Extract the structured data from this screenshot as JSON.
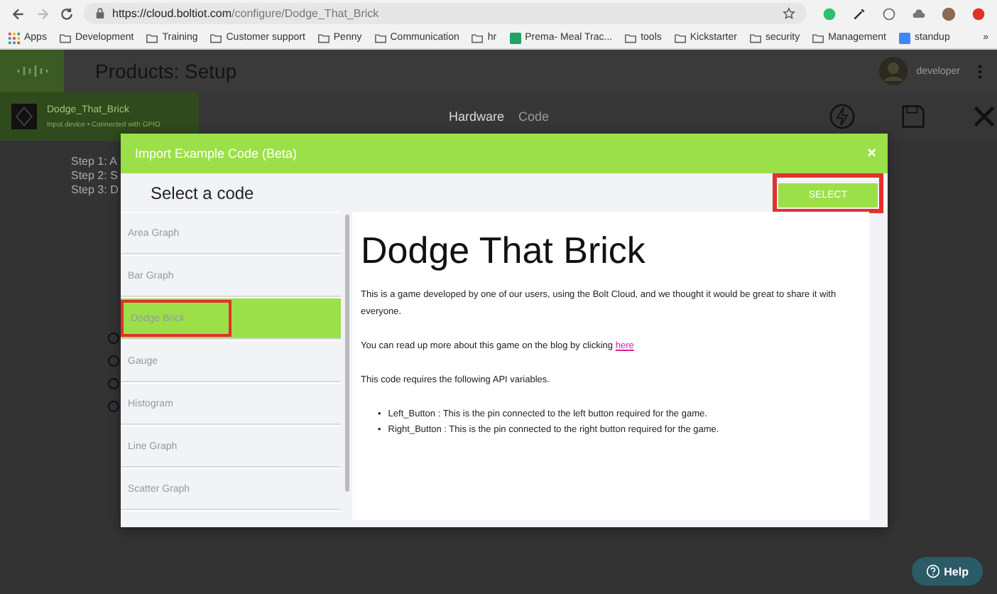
{
  "browser": {
    "url_host": "https://cloud.boltiot.com",
    "url_path": "/configure/Dodge_That_Brick",
    "bookmarks": [
      {
        "label": "Apps",
        "kind": "apps"
      },
      {
        "label": "Development",
        "kind": "folder"
      },
      {
        "label": "Training",
        "kind": "folder"
      },
      {
        "label": "Customer support",
        "kind": "folder"
      },
      {
        "label": "Penny",
        "kind": "folder"
      },
      {
        "label": "Communication",
        "kind": "folder"
      },
      {
        "label": "hr",
        "kind": "folder"
      },
      {
        "label": "Prema- Meal Trac...",
        "kind": "sheet"
      },
      {
        "label": "tools",
        "kind": "folder"
      },
      {
        "label": "Kickstarter",
        "kind": "folder"
      },
      {
        "label": "security",
        "kind": "folder"
      },
      {
        "label": "Management",
        "kind": "folder"
      },
      {
        "label": "standup",
        "kind": "doc"
      }
    ],
    "more": "»"
  },
  "app": {
    "title": "Products: Setup",
    "user": "developer",
    "device": {
      "name": "Dodge_That_Brick",
      "subtitle": "Input device • Connected with GPIO"
    },
    "tabs": [
      {
        "label": "Hardware",
        "selected": true
      },
      {
        "label": "Code",
        "selected": false
      }
    ],
    "steps": [
      "Step 1: A",
      "Step 2: S",
      "Step 3: D"
    ],
    "radios": [
      {
        "checked": false
      },
      {
        "checked": false
      },
      {
        "checked": false
      },
      {
        "checked": false
      }
    ],
    "help": "Help"
  },
  "modal": {
    "title": "Import Example Code (Beta)",
    "close": "×",
    "subtitle": "Select a code",
    "select_button": {
      "label": "SELECT",
      "highlighted": true
    },
    "items": [
      {
        "label": "Area Graph",
        "selected": false,
        "highlighted": false
      },
      {
        "label": "Bar Graph",
        "selected": false,
        "highlighted": false
      },
      {
        "label": "Dodge Brick",
        "selected": true,
        "highlighted": true
      },
      {
        "label": "Gauge",
        "selected": false,
        "highlighted": false
      },
      {
        "label": "Histogram",
        "selected": false,
        "highlighted": false
      },
      {
        "label": "Line Graph",
        "selected": false,
        "highlighted": false
      },
      {
        "label": "Scatter Graph",
        "selected": false,
        "highlighted": false
      }
    ],
    "content": {
      "heading": "Dodge That Brick",
      "intro": "This is a game developed by one of our users, using the Bolt Cloud, and we thought it would be great to share it with everyone.",
      "blog_text": "You can read up more about this game on the blog by clicking",
      "blog_link": "here",
      "requires": "This code requires the following API variables.",
      "bullet": "•",
      "variables": [
        "Left_Button : This is the pin connected to the left button required for the game.",
        "Right_Button : This is the pin connected to the right button required for the game."
      ]
    }
  }
}
